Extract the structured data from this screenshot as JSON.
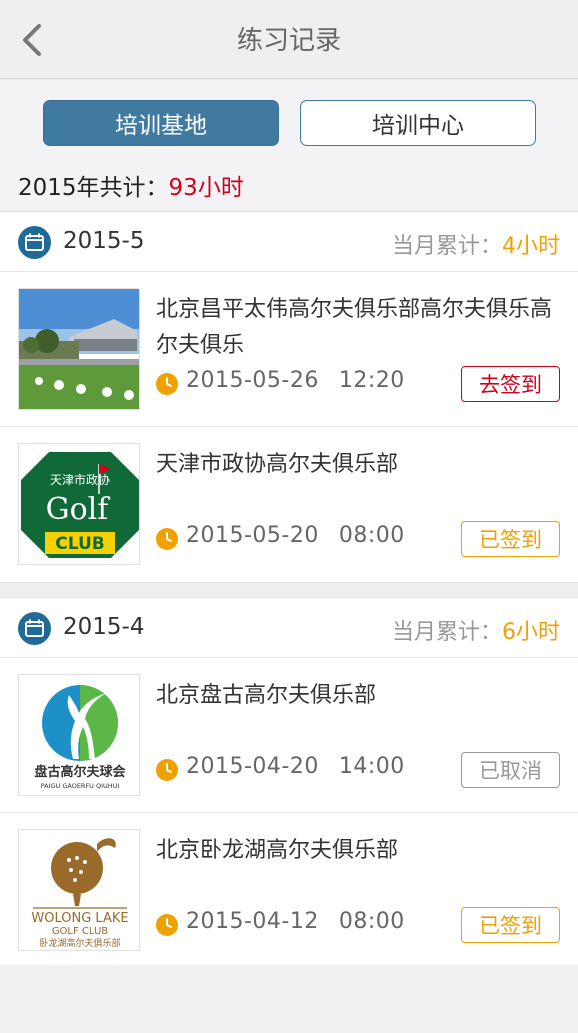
{
  "header": {
    "title": "练习记录",
    "back_icon": "chevron-left-icon"
  },
  "tabs": [
    {
      "label": "培训基地",
      "active": true
    },
    {
      "label": "培训中心",
      "active": false
    }
  ],
  "summary": {
    "prefix": "2015年共计：",
    "value": "93小时"
  },
  "colors": {
    "accent": "#417aa0",
    "red": "#d0021b",
    "orange": "#f0a000",
    "gray": "#999999"
  },
  "months": [
    {
      "month": "2015-5",
      "total_label": "当月累计：",
      "total_value": "4小时",
      "records": [
        {
          "club": "北京昌平太伟高尔夫俱乐部高尔夫俱乐高尔夫俱乐",
          "date": "2015-05-26",
          "time": "12:20",
          "status": "去签到"
        },
        {
          "club": "天津市政协高尔夫俱乐部",
          "date": "2015-05-20",
          "time": "08:00",
          "status": "已签到"
        }
      ]
    },
    {
      "month": "2015-4",
      "total_label": "当月累计：",
      "total_value": "6小时",
      "records": [
        {
          "club": "北京盘古高尔夫俱乐部",
          "date": "2015-04-20",
          "time": "14:00",
          "status": "已取消"
        },
        {
          "club": "北京卧龙湖高尔夫俱乐部",
          "date": "2015-04-12",
          "time": "08:00",
          "status": "已签到"
        }
      ]
    }
  ],
  "logos": {
    "tianjin_top": "天津市政协",
    "tianjin_word": "Golf",
    "tianjin_club": "CLUB",
    "pangu_cn": "盘古高尔夫球会",
    "pangu_en": "PAIGU GAOERFU QIUHUI",
    "wolong_name": "WOLONG LAKE",
    "wolong_club": "GOLF CLUB",
    "wolong_cn": "卧龙湖高尔夫俱乐部"
  }
}
